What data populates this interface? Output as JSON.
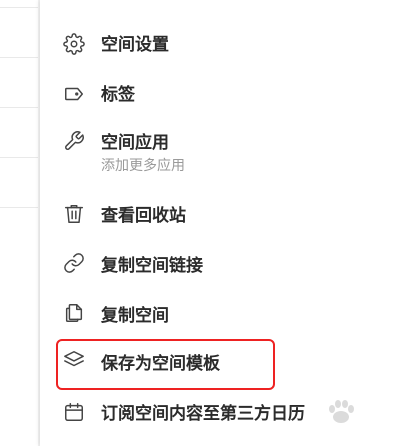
{
  "menu": {
    "items": [
      {
        "id": "space-settings",
        "label": "空间设置",
        "icon": "gear-icon"
      },
      {
        "id": "tags",
        "label": "标签",
        "icon": "tag-icon"
      },
      {
        "id": "space-apps",
        "label": "空间应用",
        "sublabel": "添加更多应用",
        "icon": "wrench-icon"
      },
      {
        "id": "recycle-bin",
        "label": "查看回收站",
        "icon": "trash-icon"
      },
      {
        "id": "copy-link",
        "label": "复制空间链接",
        "icon": "link-icon"
      },
      {
        "id": "copy-space",
        "label": "复制空间",
        "icon": "copy-icon"
      },
      {
        "id": "save-template",
        "label": "保存为空间模板",
        "icon": "layers-icon",
        "highlighted": true
      },
      {
        "id": "subscribe-calendar",
        "label": "订阅空间内容至第三方日历",
        "icon": "calendar-icon"
      }
    ]
  },
  "highlight_color": "#ee2222"
}
